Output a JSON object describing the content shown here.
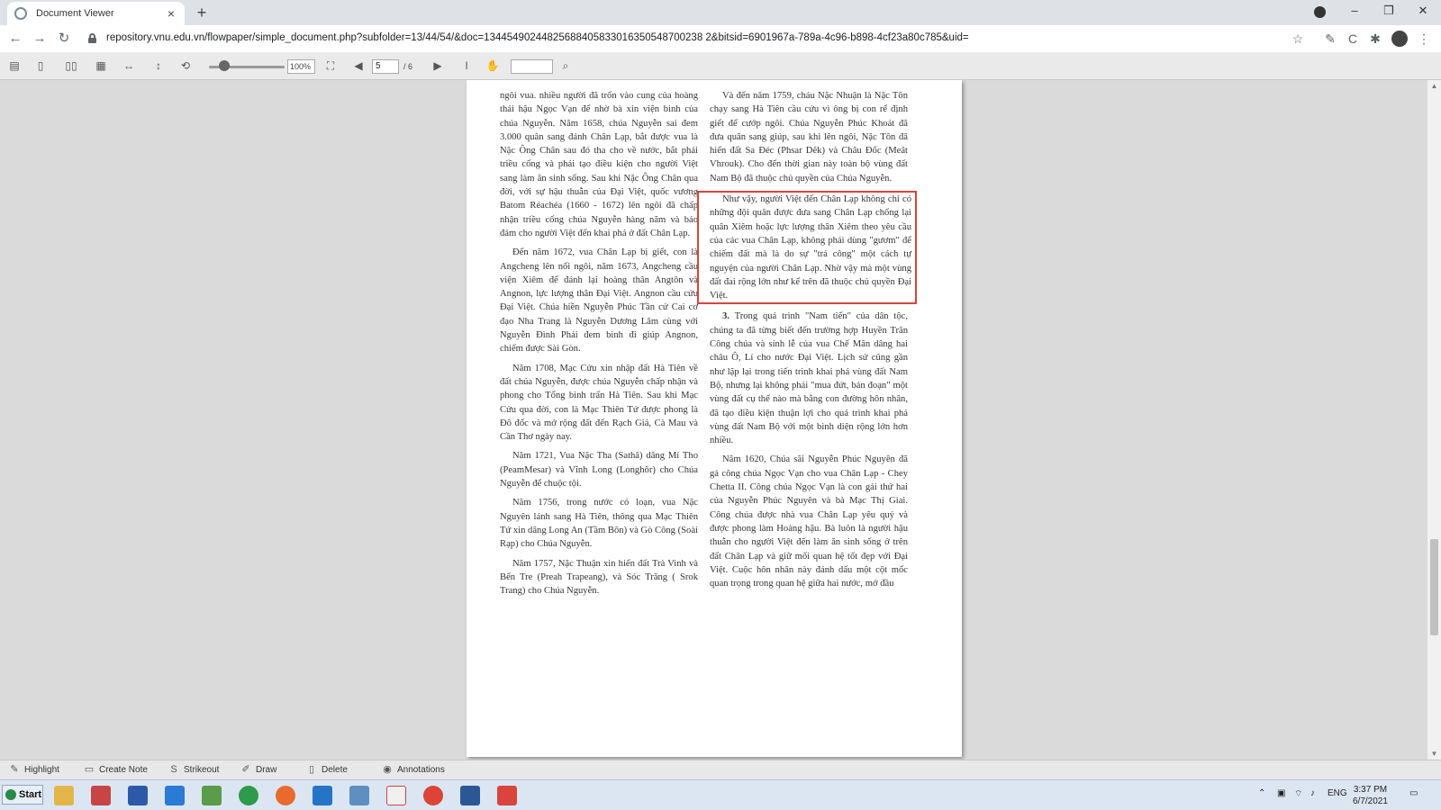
{
  "browser": {
    "tab_title": "Document Viewer",
    "tab_close": "×",
    "new_tab": "+",
    "url_host": "repository.vnu.edu.vn",
    "url_rest": "/flowpaper/simple_document.php?subfolder=13/44/54/&doc=13445490244825688405833016350548700238 2&bitsid=6901967a-789a-4c96-b898-4cf23a80c785&uid=",
    "window_controls": {
      "minimize": "–",
      "restore": "❐",
      "close": "✕"
    }
  },
  "viewer_toolbar": {
    "zoom": "100%",
    "page_current": "5",
    "page_count": "/ 6"
  },
  "document": {
    "left_column": [
      "ngôi vua. nhiều người đã trốn vào cung của hoàng thái hậu Ngọc Vạn để nhờ bà xin viện binh của chúa Nguyễn. Năm 1658, chúa Nguyễn sai đem 3.000 quân sang đánh Chân Lạp, bắt được vua là Nặc Ông Chân sau đó tha cho về nước, bắt phải triều cống và phải tạo điều kiện cho người Việt sang làm ăn sinh sống. Sau khi Nặc Ông Chân qua đời, với sự hậu thuẫn của Đại Việt, quốc vương Batom Réachéa (1660 - 1672) lên ngôi đã chấp nhận triều cống chúa Nguyễn hàng năm và bảo đảm cho người Việt đến khai phá ở đất Chân Lạp.",
      "Đến năm 1672, vua Chân Lạp bị giết, con là Angcheng lên nối ngôi, năm 1673, Angcheng cầu viện Xiêm để đánh lại hoàng thân Angtôn và Angnon, lực lượng thân Đại Việt. Angnon cầu cứu Đại Việt. Chúa hiền Nguyễn Phúc Tần cử Cai cơ đạo Nha Trang là Nguyễn Dương Lâm cùng với Nguyễn Đình Phái đem binh đi giúp Angnon, chiếm được Sài Gòn.",
      "Năm 1708, Mạc Cửu xin nhập đất Hà Tiên về đất chúa Nguyễn, được chúa Nguyễn chấp nhận và phong cho Tổng binh trấn Hà Tiên. Sau khi Mạc Cửu qua đời, con là Mạc Thiên Tứ được phong là Đô đốc và mở rộng đất đến Rạch Giá, Cà Mau và Cần Thơ ngày nay.",
      "Năm 1721, Vua Nặc Tha (Sathâ) dâng Mỉ Tho (PeamMesar) và Vĩnh Long (Longhôr) cho Chúa Nguyễn để chuộc tội.",
      "Năm 1756, trong nước có loạn, vua Nặc Nguyên lánh sang Hà Tiên, thông qua Mạc Thiên Tứ xin dâng Long An (Tầm Bôn) và Gò Công (Soài Rạp) cho Chúa Nguyễn.",
      "Năm 1757, Nặc Thuận xin hiến đất Trà Vinh và Bến Tre (Preah Trapeang), và Sóc Trăng ( Srok Trang) cho Chúa Nguyễn."
    ],
    "right_column_top": "Và đến năm 1759, cháu Nặc Nhuận là Nặc Tôn chạy sang Hà Tiên cầu cứu vì ông bị con rể định giết để cướp ngôi. Chúa Nguyễn Phúc Khoát đã đưa quân sang giúp, sau khi lên ngôi, Nặc Tôn đã hiến đất Sa Đéc (Phsar Dêk) và Châu Đốc (Meât Vhrouk). Cho đến thời gian này toàn bộ vùng đất Nam Bộ đã thuộc chủ quyền của Chúa Nguyễn.",
    "right_column_highlight": "Như vậy, người Việt đến Chân Lạp không chỉ có những đội quân được đưa sang Chân Lạp chống lại quân Xiêm hoặc lực lượng thân Xiêm theo yêu cầu của các vua Chân Lạp, không phải dùng \"gươm\" để chiếm đất mà là do sự \"trả công\" một cách tự nguyện của người Chân Lạp. Nhờ vậy mà một vùng đất đai rộng lớn như kể trên đã thuộc chủ quyền Đại Việt.",
    "right_column_num": "3.",
    "right_column_p3": "Trong quá trình \"Nam tiến\" của dân tộc, chúng ta đã từng biết đến trường hợp Huyền Trân Công chúa và sính lễ của vua Chế Mân dâng hai châu Ô, Lí cho nước Đại Việt. Lịch sử cũng gần như lặp lại trong tiến trình khai phá vùng đất Nam Bộ, nhưng lại không phải \"mua đứt, bán đoạn\" một vùng đất cụ thể nào mà bằng con đường hôn nhân, đã tạo điều kiện thuận lợi cho quá trình khai phá vùng đất Nam Bộ với một bình diện rộng lớn hơn nhiều.",
    "right_column_p4": "Năm 1620, Chúa sãi Nguyễn Phúc Nguyên đã gả công chúa Ngọc Vạn cho vua Chân Lạp - Chey Chetta II. Công chúa Ngọc Vạn là con gái thứ hai của Nguyễn Phúc Nguyên và bà Mạc Thị Giai. Công chúa được nhà vua Chân Lạp yêu quý và được phong làm Hoàng hậu. Bà luôn là người hậu thuẫn cho người Việt đến làm ăn sinh sống ở trên đất Chân Lạp và giữ mối quan hệ tốt đẹp với Đại Việt. Cuộc hôn nhân này đánh dấu một cột mốc quan trọng trong quan hệ giữa hai nước, mở đầu"
  },
  "annotation_bar": {
    "highlight": "Highlight",
    "create_note": "Create Note",
    "strikeout": "Strikeout",
    "draw": "Draw",
    "delete": "Delete",
    "annotations": "Annotations"
  },
  "taskbar": {
    "start": "Start",
    "lang": "ENG",
    "time": "3:37 PM",
    "date": "6/7/2021"
  },
  "colors": {
    "highlight_border": "#d9443c",
    "page_bg": "#ffffff",
    "viewer_bg": "#dadada"
  }
}
